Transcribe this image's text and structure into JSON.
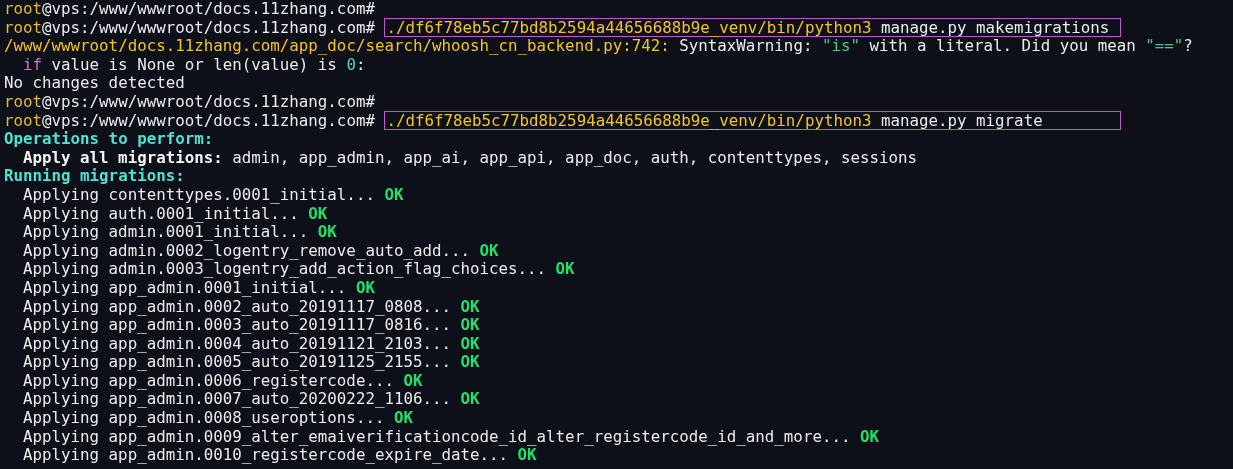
{
  "terminal": {
    "lines": [
      {
        "kind": "prompt",
        "user": "root",
        "location": "@vps:/www/wwwroot/docs.11zhang.com#"
      },
      {
        "kind": "prompt",
        "user": "root",
        "location": "@vps:/www/wwwroot/docs.11zhang.com#",
        "command": {
          "program": "./df6f78eb5c77bd8b2594a44656688b9e_venv/bin/python3",
          "args": "manage.py makemigrations",
          "highlighted": true
        }
      },
      {
        "kind": "output",
        "indented": false,
        "segments": [
          {
            "kind": "path",
            "text": "/www/wwwroot/docs.11zhang.com/app_doc/search/whoosh_cn_backend.py:742:"
          },
          {
            "kind": "plain",
            "text": "SyntaxWarning:"
          },
          {
            "kind": "string",
            "text": "\"is\""
          },
          {
            "kind": "plain",
            "text": "with a literal. Did you mean"
          },
          {
            "kind": "string",
            "text": "\"==\""
          },
          {
            "kind": "glued",
            "text": "?"
          }
        ]
      },
      {
        "kind": "output",
        "indented": true,
        "segments": [
          {
            "kind": "keyword",
            "text": "if"
          },
          {
            "kind": "plain",
            "text": "value is None or len(value) is"
          },
          {
            "kind": "number",
            "text": "0"
          },
          {
            "kind": "glued",
            "text": ":"
          }
        ]
      },
      {
        "kind": "output",
        "indented": false,
        "segments": [
          {
            "kind": "plain",
            "text": "No changes detected"
          }
        ]
      },
      {
        "kind": "prompt",
        "user": "root",
        "location": "@vps:/www/wwwroot/docs.11zhang.com#"
      },
      {
        "kind": "prompt",
        "user": "root",
        "location": "@vps:/www/wwwroot/docs.11zhang.com#",
        "command": {
          "program": "./df6f78eb5c77bd8b2594a44656688b9e_venv/bin/python3",
          "args": "manage.py migrate",
          "highlighted": true
        }
      },
      {
        "kind": "output",
        "indented": false,
        "segments": [
          {
            "kind": "heading",
            "text": "Operations to perform:"
          }
        ]
      },
      {
        "kind": "output",
        "indented": true,
        "segments": [
          {
            "kind": "label",
            "text": "Apply all migrations:"
          },
          {
            "kind": "plain",
            "text": "admin, app_admin, app_ai, app_api, app_doc, auth, contenttypes, sessions"
          }
        ]
      },
      {
        "kind": "output",
        "indented": false,
        "segments": [
          {
            "kind": "heading",
            "text": "Running migrations:"
          }
        ]
      },
      {
        "kind": "output",
        "indented": true,
        "segments": [
          {
            "kind": "plain",
            "text": "Applying contenttypes.0001_initial..."
          },
          {
            "kind": "ok",
            "text": "OK"
          }
        ]
      },
      {
        "kind": "output",
        "indented": true,
        "segments": [
          {
            "kind": "plain",
            "text": "Applying auth.0001_initial..."
          },
          {
            "kind": "ok",
            "text": "OK"
          }
        ]
      },
      {
        "kind": "output",
        "indented": true,
        "segments": [
          {
            "kind": "plain",
            "text": "Applying admin.0001_initial..."
          },
          {
            "kind": "ok",
            "text": "OK"
          }
        ]
      },
      {
        "kind": "output",
        "indented": true,
        "segments": [
          {
            "kind": "plain",
            "text": "Applying admin.0002_logentry_remove_auto_add..."
          },
          {
            "kind": "ok",
            "text": "OK"
          }
        ]
      },
      {
        "kind": "output",
        "indented": true,
        "segments": [
          {
            "kind": "plain",
            "text": "Applying admin.0003_logentry_add_action_flag_choices..."
          },
          {
            "kind": "ok",
            "text": "OK"
          }
        ]
      },
      {
        "kind": "output",
        "indented": true,
        "segments": [
          {
            "kind": "plain",
            "text": "Applying app_admin.0001_initial..."
          },
          {
            "kind": "ok",
            "text": "OK"
          }
        ]
      },
      {
        "kind": "output",
        "indented": true,
        "segments": [
          {
            "kind": "plain",
            "text": "Applying app_admin.0002_auto_20191117_0808..."
          },
          {
            "kind": "ok",
            "text": "OK"
          }
        ]
      },
      {
        "kind": "output",
        "indented": true,
        "segments": [
          {
            "kind": "plain",
            "text": "Applying app_admin.0003_auto_20191117_0816..."
          },
          {
            "kind": "ok",
            "text": "OK"
          }
        ]
      },
      {
        "kind": "output",
        "indented": true,
        "segments": [
          {
            "kind": "plain",
            "text": "Applying app_admin.0004_auto_20191121_2103..."
          },
          {
            "kind": "ok",
            "text": "OK"
          }
        ]
      },
      {
        "kind": "output",
        "indented": true,
        "segments": [
          {
            "kind": "plain",
            "text": "Applying app_admin.0005_auto_20191125_2155..."
          },
          {
            "kind": "ok",
            "text": "OK"
          }
        ]
      },
      {
        "kind": "output",
        "indented": true,
        "segments": [
          {
            "kind": "plain",
            "text": "Applying app_admin.0006_registercode..."
          },
          {
            "kind": "ok",
            "text": "OK"
          }
        ]
      },
      {
        "kind": "output",
        "indented": true,
        "segments": [
          {
            "kind": "plain",
            "text": "Applying app_admin.0007_auto_20200222_1106..."
          },
          {
            "kind": "ok",
            "text": "OK"
          }
        ]
      },
      {
        "kind": "output",
        "indented": true,
        "segments": [
          {
            "kind": "plain",
            "text": "Applying app_admin.0008_useroptions..."
          },
          {
            "kind": "ok",
            "text": "OK"
          }
        ]
      },
      {
        "kind": "output",
        "indented": true,
        "segments": [
          {
            "kind": "plain",
            "text": "Applying app_admin.0009_alter_emaiverificationcode_id_alter_registercode_id_and_more..."
          },
          {
            "kind": "ok",
            "text": "OK"
          }
        ]
      },
      {
        "kind": "output",
        "indented": true,
        "segments": [
          {
            "kind": "plain",
            "text": "Applying app_admin.0010_registercode_expire_date..."
          },
          {
            "kind": "ok",
            "text": "OK"
          }
        ]
      }
    ]
  }
}
